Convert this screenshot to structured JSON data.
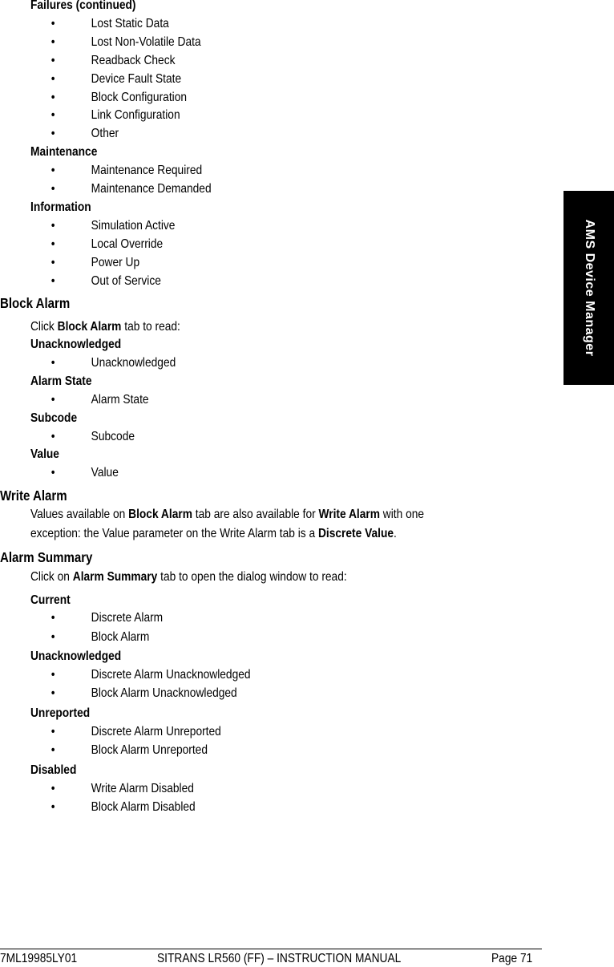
{
  "side_tab": "AMS Device Manager",
  "sections": {
    "failures": {
      "heading": "Failures (continued)",
      "items": [
        "Lost Static Data",
        "Lost Non-Volatile Data",
        "Readback Check",
        "Device Fault State",
        "Block Configuration",
        "Link Configuration",
        "Other"
      ]
    },
    "maintenance": {
      "heading": "Maintenance",
      "items": [
        "Maintenance Required",
        "Maintenance Demanded"
      ]
    },
    "information": {
      "heading": "Information",
      "items": [
        "Simulation Active",
        "Local Override",
        "Power Up",
        "Out of Service"
      ]
    },
    "block_alarm": {
      "title": "Block Alarm",
      "intro_pre": "Click ",
      "intro_bold": "Block Alarm",
      "intro_post": " tab to read:",
      "groups": [
        {
          "heading": "Unacknowledged",
          "items": [
            "Unacknowledged"
          ]
        },
        {
          "heading": "Alarm State",
          "items": [
            "Alarm State"
          ]
        },
        {
          "heading": "Subcode",
          "items": [
            "Subcode"
          ]
        },
        {
          "heading": "Value",
          "items": [
            "Value"
          ]
        }
      ]
    },
    "write_alarm": {
      "title": "Write Alarm",
      "p1_a": "Values available on ",
      "p1_b": "Block Alarm",
      "p1_c": " tab are also available for ",
      "p1_d": "Write Alarm",
      "p1_e": " with one",
      "p2_a": "exception: the Value parameter on the Write Alarm tab is a ",
      "p2_b": "Discrete Value",
      "p2_c": "."
    },
    "alarm_summary": {
      "title": "Alarm Summary",
      "intro_pre": "Click on ",
      "intro_bold": "Alarm Summary",
      "intro_post": " tab to open the dialog window to read:",
      "groups": [
        {
          "heading": "Current",
          "items": [
            "Discrete Alarm",
            "Block Alarm"
          ]
        },
        {
          "heading": "Unacknowledged",
          "items": [
            "Discrete Alarm Unacknowledged",
            "Block Alarm Unacknowledged"
          ]
        },
        {
          "heading": "Unreported",
          "items": [
            "Discrete Alarm Unreported",
            "Block Alarm Unreported"
          ]
        },
        {
          "heading": "Disabled",
          "items": [
            "Write Alarm Disabled",
            "Block Alarm Disabled"
          ]
        }
      ]
    }
  },
  "bullet": "•",
  "footer": {
    "doc_number": "7ML19985LY01",
    "title": "SITRANS LR560 (FF) – INSTRUCTION MANUAL",
    "page": "Page 71"
  }
}
